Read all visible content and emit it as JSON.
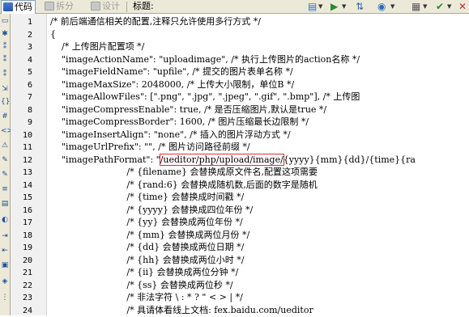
{
  "toolbar": {
    "code_label": "代码",
    "split_label": "拆分",
    "design_label": "设计",
    "title_label": "标题:",
    "title_value": ""
  },
  "gutter": {
    "line_numbers": [
      "1",
      "2",
      "3",
      "4",
      "5",
      "6",
      "7",
      "8",
      "9",
      "10",
      "11",
      "12",
      "13",
      "14",
      "15",
      "16",
      "17",
      "18",
      "19",
      "20",
      "21",
      "22",
      "23",
      "24"
    ]
  },
  "editor": {
    "lines": [
      "/* 前后端通信相关的配置,注释只允许使用多行方式 */",
      "{",
      "    /* 上传图片配置项 */",
      "    \"imageActionName\": \"uploadimage\", /* 执行上传图片的action名称 */",
      "    \"imageFieldName\": \"upfile\", /* 提交的图片表单名称 */",
      "    \"imageMaxSize\": 2048000, /* 上传大小限制，单位B */",
      "    \"imageAllowFiles\": [\".png\", \".jpg\", \".jpeg\", \".gif\", \".bmp\"], /* 上传图",
      "    \"imageCompressEnable\": true, /* 是否压缩图片,默认是true */",
      "    \"imageCompressBorder\": 1600, /* 图片压缩最长边限制 */",
      "    \"imageInsertAlign\": \"none\", /* 插入的图片浮动方式 */",
      "    \"imageUrlPrefix\": \"\", /* 图片访问路径前缀 */",
      "    \"imagePathFormat\": \"",
      "                           /* {filename} 会替换成原文件名,配置这项需要",
      "                           /* {rand:6} 会替换成随机数,后面的数字是随机",
      "                           /* {time} 会替换成时间戳 */",
      "                           /* {yyyy} 会替换成四位年份 */",
      "                           /* {yy} 会替换成两位年份 */",
      "                           /* {mm} 会替换成两位月份 */",
      "                           /* {dd} 会替换成两位日期 */",
      "                           /* {hh} 会替换成两位小时 */",
      "                           /* {ii} 会替换成两位分钟 */",
      "                           /* {ss} 会替换成两位秒 */",
      "                           /* 非法字符 \\ : * ? \" < > | */",
      "                           /* 具请体看线上文档: fex.baidu.com/ueditor"
    ],
    "highlighted_path": "/ueditor/php/upload/image/",
    "line12_tail": "{yyyy}{mm}{dd}/{time}{ra"
  },
  "colors": {
    "highlight_border": "#e03030",
    "toolbar_bg": "#ece9d8"
  }
}
